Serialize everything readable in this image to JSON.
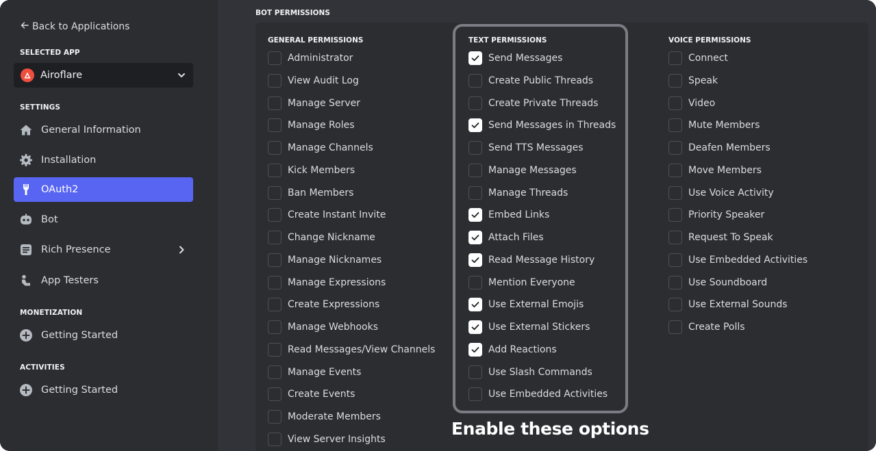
{
  "sidebar": {
    "back_label": "Back to Applications",
    "selected_app_heading": "SELECTED APP",
    "app_name": "Airoflare",
    "settings_heading": "SETTINGS",
    "settings_items": [
      {
        "label": "General Information",
        "icon": "home-icon"
      },
      {
        "label": "Installation",
        "icon": "gear-icon"
      },
      {
        "label": "OAuth2",
        "icon": "wrench-icon",
        "active": true
      },
      {
        "label": "Bot",
        "icon": "bot-icon"
      },
      {
        "label": "Rich Presence",
        "icon": "document-icon",
        "has_children": true
      },
      {
        "label": "App Testers",
        "icon": "person-icon"
      }
    ],
    "monetization_heading": "MONETIZATION",
    "monetization_items": [
      {
        "label": "Getting Started",
        "icon": "plus-circle-icon"
      }
    ],
    "activities_heading": "ACTIVITIES",
    "activities_items": [
      {
        "label": "Getting Started",
        "icon": "plus-circle-icon"
      }
    ]
  },
  "main": {
    "section_title": "BOT PERMISSIONS",
    "columns": [
      {
        "heading": "GENERAL PERMISSIONS",
        "items": [
          {
            "label": "Administrator",
            "checked": false
          },
          {
            "label": "View Audit Log",
            "checked": false
          },
          {
            "label": "Manage Server",
            "checked": false
          },
          {
            "label": "Manage Roles",
            "checked": false
          },
          {
            "label": "Manage Channels",
            "checked": false
          },
          {
            "label": "Kick Members",
            "checked": false
          },
          {
            "label": "Ban Members",
            "checked": false
          },
          {
            "label": "Create Instant Invite",
            "checked": false
          },
          {
            "label": "Change Nickname",
            "checked": false
          },
          {
            "label": "Manage Nicknames",
            "checked": false
          },
          {
            "label": "Manage Expressions",
            "checked": false
          },
          {
            "label": "Create Expressions",
            "checked": false
          },
          {
            "label": "Manage Webhooks",
            "checked": false
          },
          {
            "label": "Read Messages/View Channels",
            "checked": false
          },
          {
            "label": "Manage Events",
            "checked": false
          },
          {
            "label": "Create Events",
            "checked": false
          },
          {
            "label": "Moderate Members",
            "checked": false
          },
          {
            "label": "View Server Insights",
            "checked": false
          }
        ]
      },
      {
        "heading": "TEXT PERMISSIONS",
        "items": [
          {
            "label": "Send Messages",
            "checked": true
          },
          {
            "label": "Create Public Threads",
            "checked": false
          },
          {
            "label": "Create Private Threads",
            "checked": false
          },
          {
            "label": "Send Messages in Threads",
            "checked": true
          },
          {
            "label": "Send TTS Messages",
            "checked": false
          },
          {
            "label": "Manage Messages",
            "checked": false
          },
          {
            "label": "Manage Threads",
            "checked": false
          },
          {
            "label": "Embed Links",
            "checked": true
          },
          {
            "label": "Attach Files",
            "checked": true
          },
          {
            "label": "Read Message History",
            "checked": true
          },
          {
            "label": "Mention Everyone",
            "checked": false
          },
          {
            "label": "Use External Emojis",
            "checked": true
          },
          {
            "label": "Use External Stickers",
            "checked": true
          },
          {
            "label": "Add Reactions",
            "checked": true
          },
          {
            "label": "Use Slash Commands",
            "checked": false
          },
          {
            "label": "Use Embedded Activities",
            "checked": false
          }
        ]
      },
      {
        "heading": "VOICE PERMISSIONS",
        "items": [
          {
            "label": "Connect",
            "checked": false
          },
          {
            "label": "Speak",
            "checked": false
          },
          {
            "label": "Video",
            "checked": false
          },
          {
            "label": "Mute Members",
            "checked": false
          },
          {
            "label": "Deafen Members",
            "checked": false
          },
          {
            "label": "Move Members",
            "checked": false
          },
          {
            "label": "Use Voice Activity",
            "checked": false
          },
          {
            "label": "Priority Speaker",
            "checked": false
          },
          {
            "label": "Request To Speak",
            "checked": false
          },
          {
            "label": "Use Embedded Activities",
            "checked": false
          },
          {
            "label": "Use Soundboard",
            "checked": false
          },
          {
            "label": "Use External Sounds",
            "checked": false
          },
          {
            "label": "Create Polls",
            "checked": false
          }
        ]
      }
    ],
    "annotation": "Enable these options"
  },
  "colors": {
    "accent": "#5865f2",
    "sidebar_bg": "#2b2d31",
    "main_bg": "#313338",
    "app_logo": "#f04e3e"
  }
}
